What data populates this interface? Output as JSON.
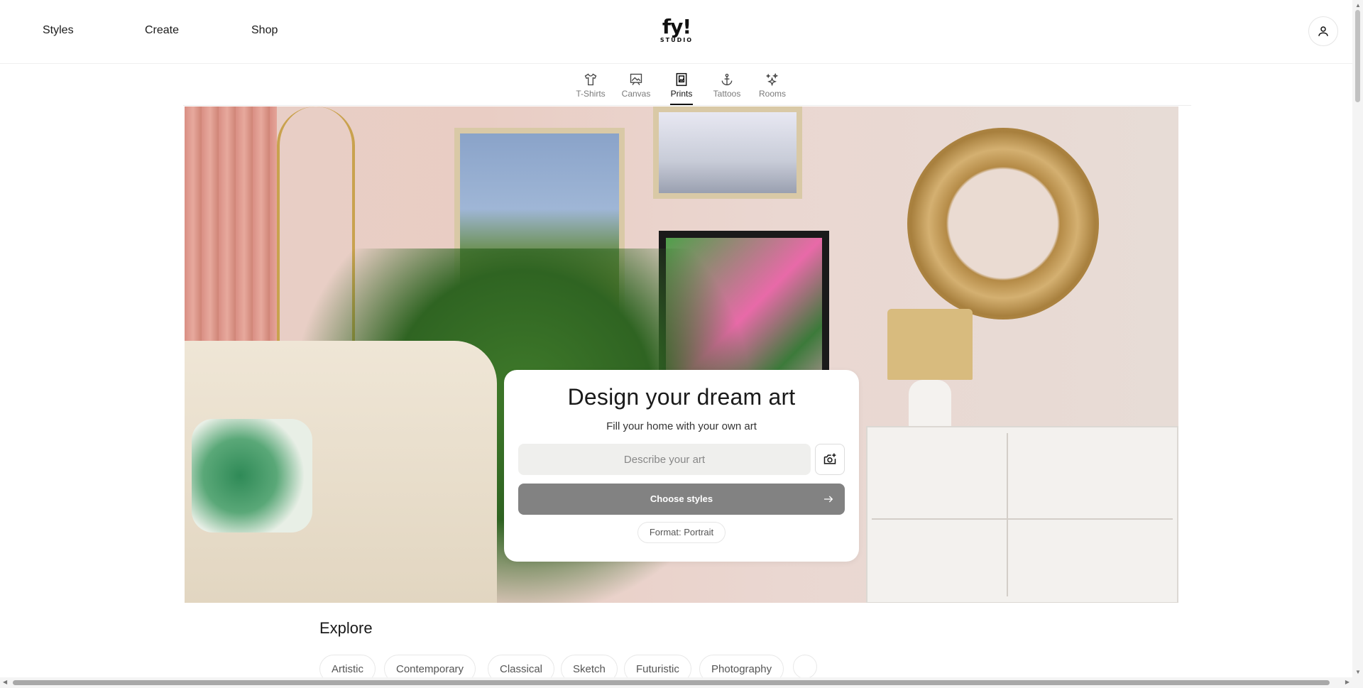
{
  "header": {
    "nav": [
      "Styles",
      "Create",
      "Shop"
    ],
    "logo_main": "fy!",
    "logo_sub": "STUDIO",
    "account_icon": "user-icon"
  },
  "tabs": [
    {
      "label": "T-Shirts",
      "icon": "tshirt-icon",
      "active": false
    },
    {
      "label": "Canvas",
      "icon": "canvas-icon",
      "active": false
    },
    {
      "label": "Prints",
      "icon": "print-frame-icon",
      "active": true
    },
    {
      "label": "Tattoos",
      "icon": "anchor-icon",
      "active": false
    },
    {
      "label": "Rooms",
      "icon": "sparkle-icon",
      "active": false
    }
  ],
  "hero_card": {
    "title": "Design your dream art",
    "subtitle": "Fill your home with your own art",
    "input_placeholder": "Describe your art",
    "input_value": "",
    "camera_icon": "camera-plus-icon",
    "choose_button": "Choose styles",
    "choose_icon": "arrow-right-icon",
    "format": "Format: Portrait"
  },
  "explore": {
    "title": "Explore",
    "chips": [
      "Artistic",
      "Contemporary",
      "Classical",
      "Sketch",
      "Futuristic",
      "Photography"
    ]
  },
  "colors": {
    "choose_button_bg": "#828282",
    "input_bg": "#efefed",
    "text": "#1a1a1a",
    "muted": "#7a7a7a"
  }
}
